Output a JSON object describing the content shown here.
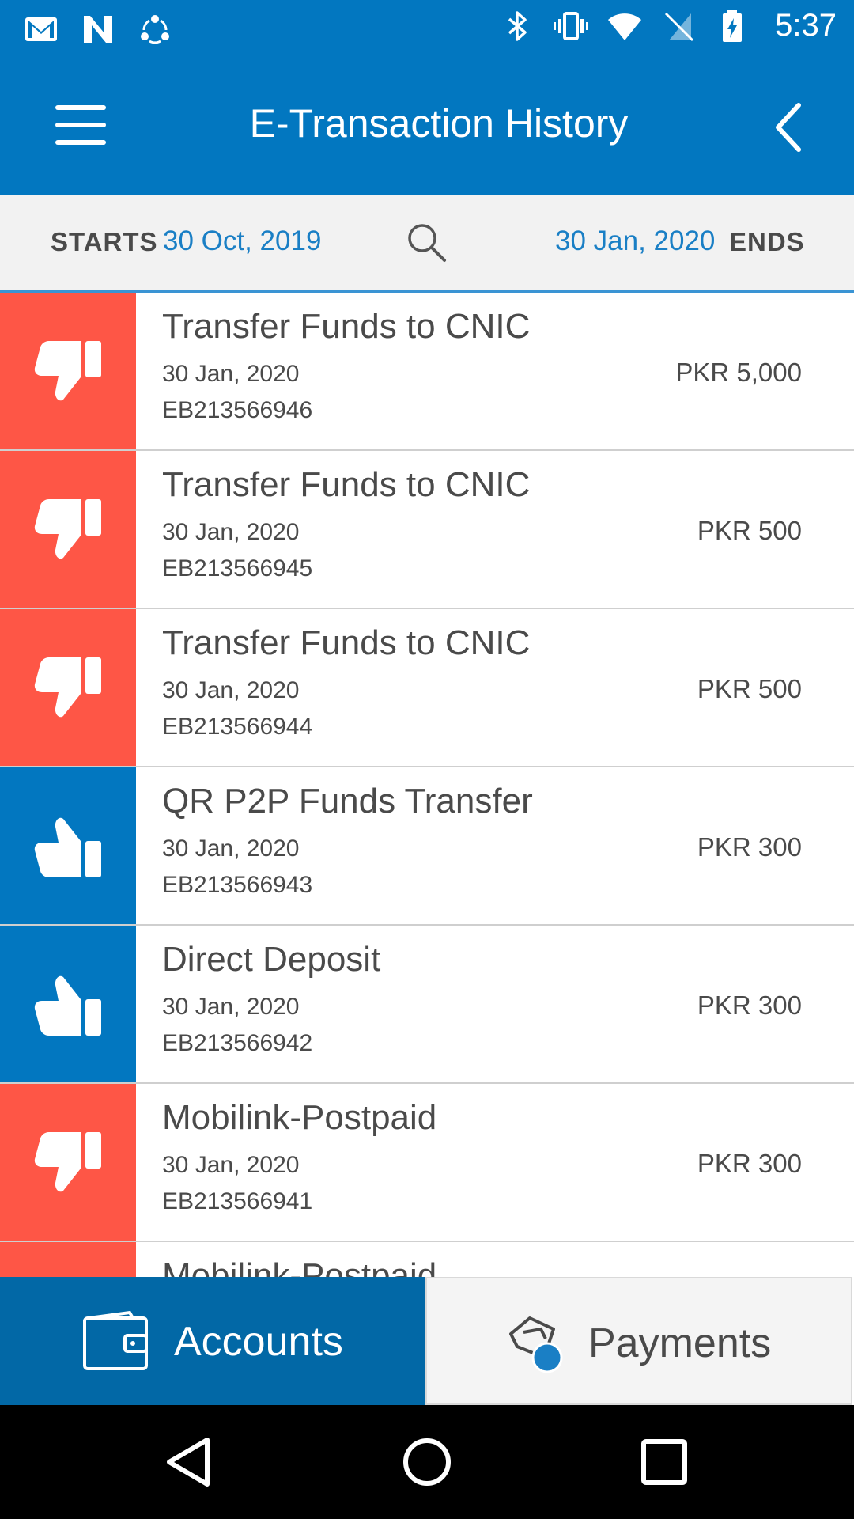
{
  "status_bar": {
    "time": "5:37",
    "left_icons": [
      "gmail-icon",
      "n-app-icon",
      "sync-app-icon"
    ],
    "right_icons": [
      "bluetooth-icon",
      "vibrate-icon",
      "wifi-icon",
      "no-sim-icon",
      "battery-charging-icon"
    ]
  },
  "app_bar": {
    "title": "E-Transaction History",
    "menu_icon": "hamburger-menu-icon",
    "back_icon": "chevron-left-icon"
  },
  "filter": {
    "start_label": "STARTS",
    "start_date": "30 Oct, 2019",
    "end_date": "30 Jan, 2020",
    "end_label": "ENDS",
    "search_icon": "search-icon"
  },
  "colors": {
    "primary": "#0277c0",
    "debit": "#fe5646",
    "credit": "#0277c0",
    "date_link": "#1a7fc5"
  },
  "transactions": [
    {
      "title": "Transfer Funds to CNIC",
      "date": "30 Jan, 2020",
      "ref": "EB213566946",
      "amount": "PKR 5,000",
      "type": "debit",
      "icon": "thumbs-down-icon"
    },
    {
      "title": "Transfer Funds to CNIC",
      "date": "30 Jan, 2020",
      "ref": "EB213566945",
      "amount": "PKR 500",
      "type": "debit",
      "icon": "thumbs-down-icon"
    },
    {
      "title": "Transfer Funds to CNIC",
      "date": "30 Jan, 2020",
      "ref": "EB213566944",
      "amount": "PKR 500",
      "type": "debit",
      "icon": "thumbs-down-icon"
    },
    {
      "title": "QR P2P Funds Transfer",
      "date": "30 Jan, 2020",
      "ref": "EB213566943",
      "amount": "PKR 300",
      "type": "credit",
      "icon": "thumbs-up-icon"
    },
    {
      "title": "Direct Deposit",
      "date": "30 Jan, 2020",
      "ref": "EB213566942",
      "amount": "PKR 300",
      "type": "credit",
      "icon": "thumbs-up-icon"
    },
    {
      "title": "Mobilink-Postpaid",
      "date": "30 Jan, 2020",
      "ref": "EB213566941",
      "amount": "PKR 300",
      "type": "debit",
      "icon": "thumbs-down-icon"
    },
    {
      "title": "Mobilink-Postpaid",
      "date": "",
      "ref": "",
      "amount": "",
      "type": "debit",
      "icon": "thumbs-down-icon"
    }
  ],
  "tabs": [
    {
      "label": "Accounts",
      "icon": "wallet-icon",
      "selected": true
    },
    {
      "label": "Payments",
      "icon": "payment-hand-icon",
      "selected": false
    }
  ],
  "nav_bar": {
    "back": "nav-back-icon",
    "home": "nav-home-icon",
    "recents": "nav-recents-icon"
  }
}
